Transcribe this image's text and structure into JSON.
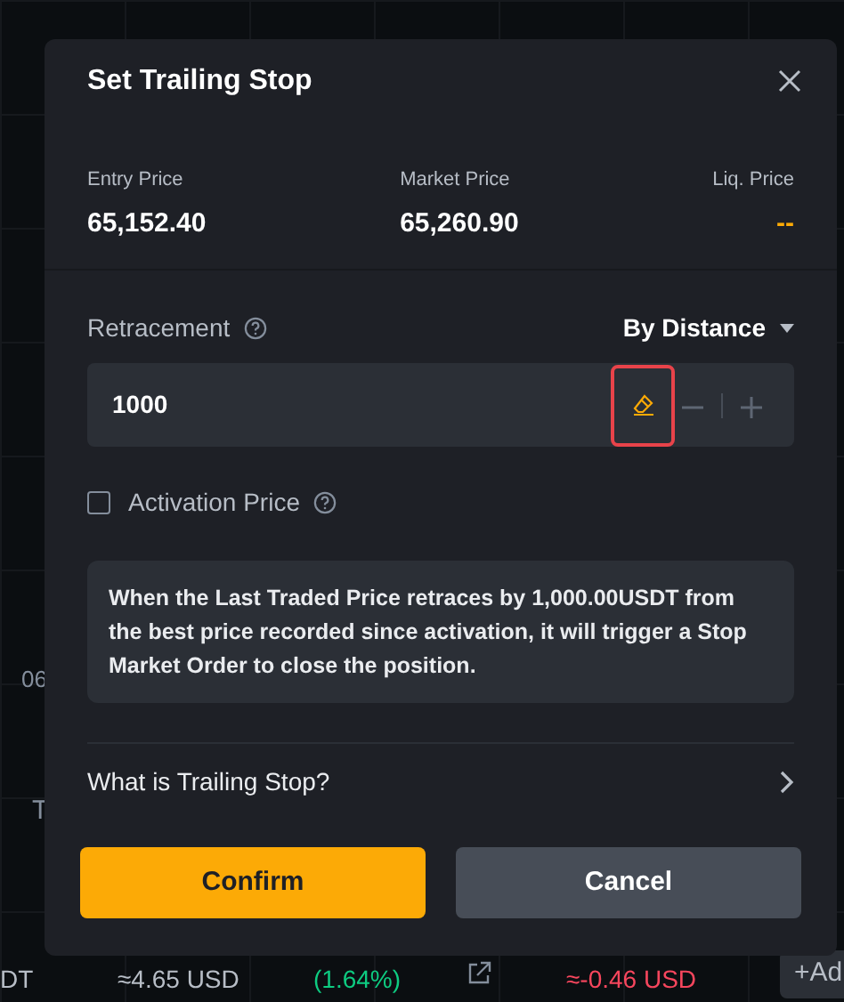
{
  "background": {
    "axis_label": "06",
    "side_label": "T",
    "bottom_row": [
      {
        "kind": "text",
        "text": "DT",
        "color": "#b7bdc6"
      },
      {
        "kind": "text",
        "text": "≈4.65 USD",
        "color": "#b7bdc6"
      },
      {
        "kind": "text",
        "text": "(1.64%)",
        "color": "#0ecb81"
      },
      {
        "kind": "icon"
      },
      {
        "kind": "text",
        "text": "≈-0.46 USD",
        "color": "#f6465d"
      },
      {
        "kind": "button",
        "text": "+Ad"
      }
    ]
  },
  "dialog": {
    "title": "Set Trailing Stop",
    "stats": [
      {
        "label": "Entry Price",
        "value": "65,152.40",
        "color": "#ffffff"
      },
      {
        "label": "Market Price",
        "value": "65,260.90",
        "color": "#ffffff"
      },
      {
        "label": "Liq. Price",
        "value": "--",
        "color": "#fcaa06"
      }
    ],
    "retracement": {
      "label": "Retracement",
      "mode": "By Distance",
      "value": "1000",
      "clear_highlighted": true
    },
    "activation": {
      "label": "Activation Price",
      "checked": false
    },
    "info": "When the Last Traded Price retraces by 1,000.00USDT from the best price recorded since activation, it will trigger a Stop Market Order to close the position.",
    "help_link": "What is Trailing Stop?",
    "buttons": [
      {
        "label": "Confirm",
        "kind": "primary"
      },
      {
        "label": "Cancel",
        "kind": "secondary"
      }
    ]
  }
}
